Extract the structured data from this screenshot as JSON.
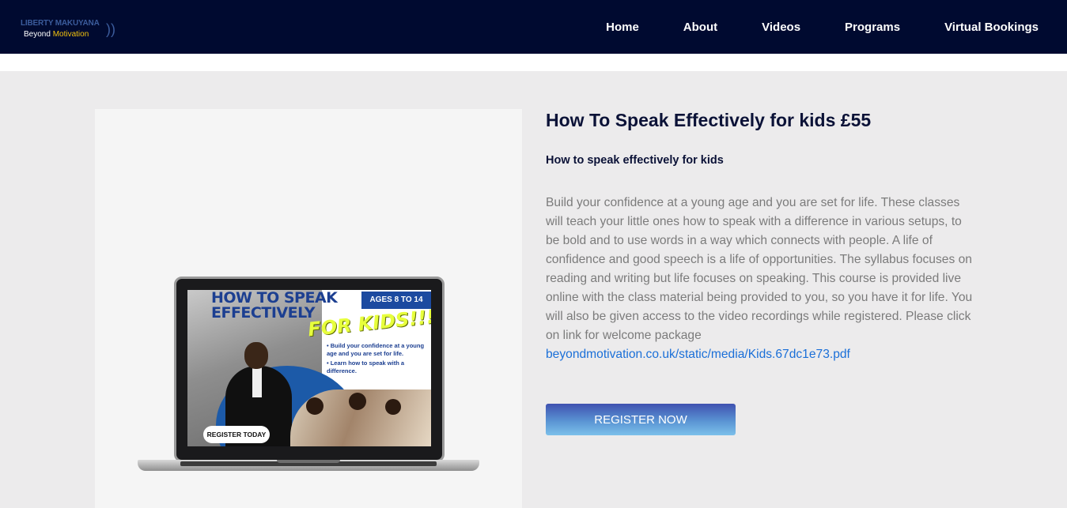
{
  "brand": {
    "name_top": "LIBERTY MAKUYANA",
    "name_bottom_1": "Beyond",
    "name_bottom_2": "Motivation",
    "accent_color": "#f4c20d"
  },
  "nav": {
    "items": [
      {
        "label": "Home"
      },
      {
        "label": "About"
      },
      {
        "label": "Videos"
      },
      {
        "label": "Programs"
      },
      {
        "label": "Virtual Bookings"
      }
    ]
  },
  "product": {
    "title": "How To Speak Effectively for kids £55",
    "subtitle": "How to speak effectively for kids",
    "description": "Build your confidence at a young age and you are set for life. These classes will teach your little ones how to speak with a difference in various setups, to be bold and to use words in a way which connects with people. A life of confidence and good speech is a life of opportunities. The syllabus focuses on reading and writing but life focuses on speaking. This course is provided live online with the class material being provided to you, so you have it for life. You will also be given access to the video recordings while registered. Please click on link for welcome package ",
    "link_text": "beyondmotivation.co.uk/static/media/Kids.67dc1e73.pdf",
    "register_label": "REGISTER NOW"
  },
  "promo": {
    "title_line1": "HOW TO SPEAK",
    "title_line2": "EFFECTIVELY",
    "for_kids": "FOR KIDS!!!",
    "age_badge": "AGES 8 TO 14",
    "bullets": [
      "• Build your confidence at a young age and you are set for life.",
      "• Learn how to speak with a difference."
    ],
    "register_today": "REGISTER TODAY"
  },
  "colors": {
    "navbar_bg": "#000a30",
    "page_bg": "#ecebec",
    "heading": "#0b1237",
    "link": "#1a6fd8",
    "button_gradient_top": "#3f52b0",
    "button_gradient_bottom": "#7cc0ea"
  }
}
